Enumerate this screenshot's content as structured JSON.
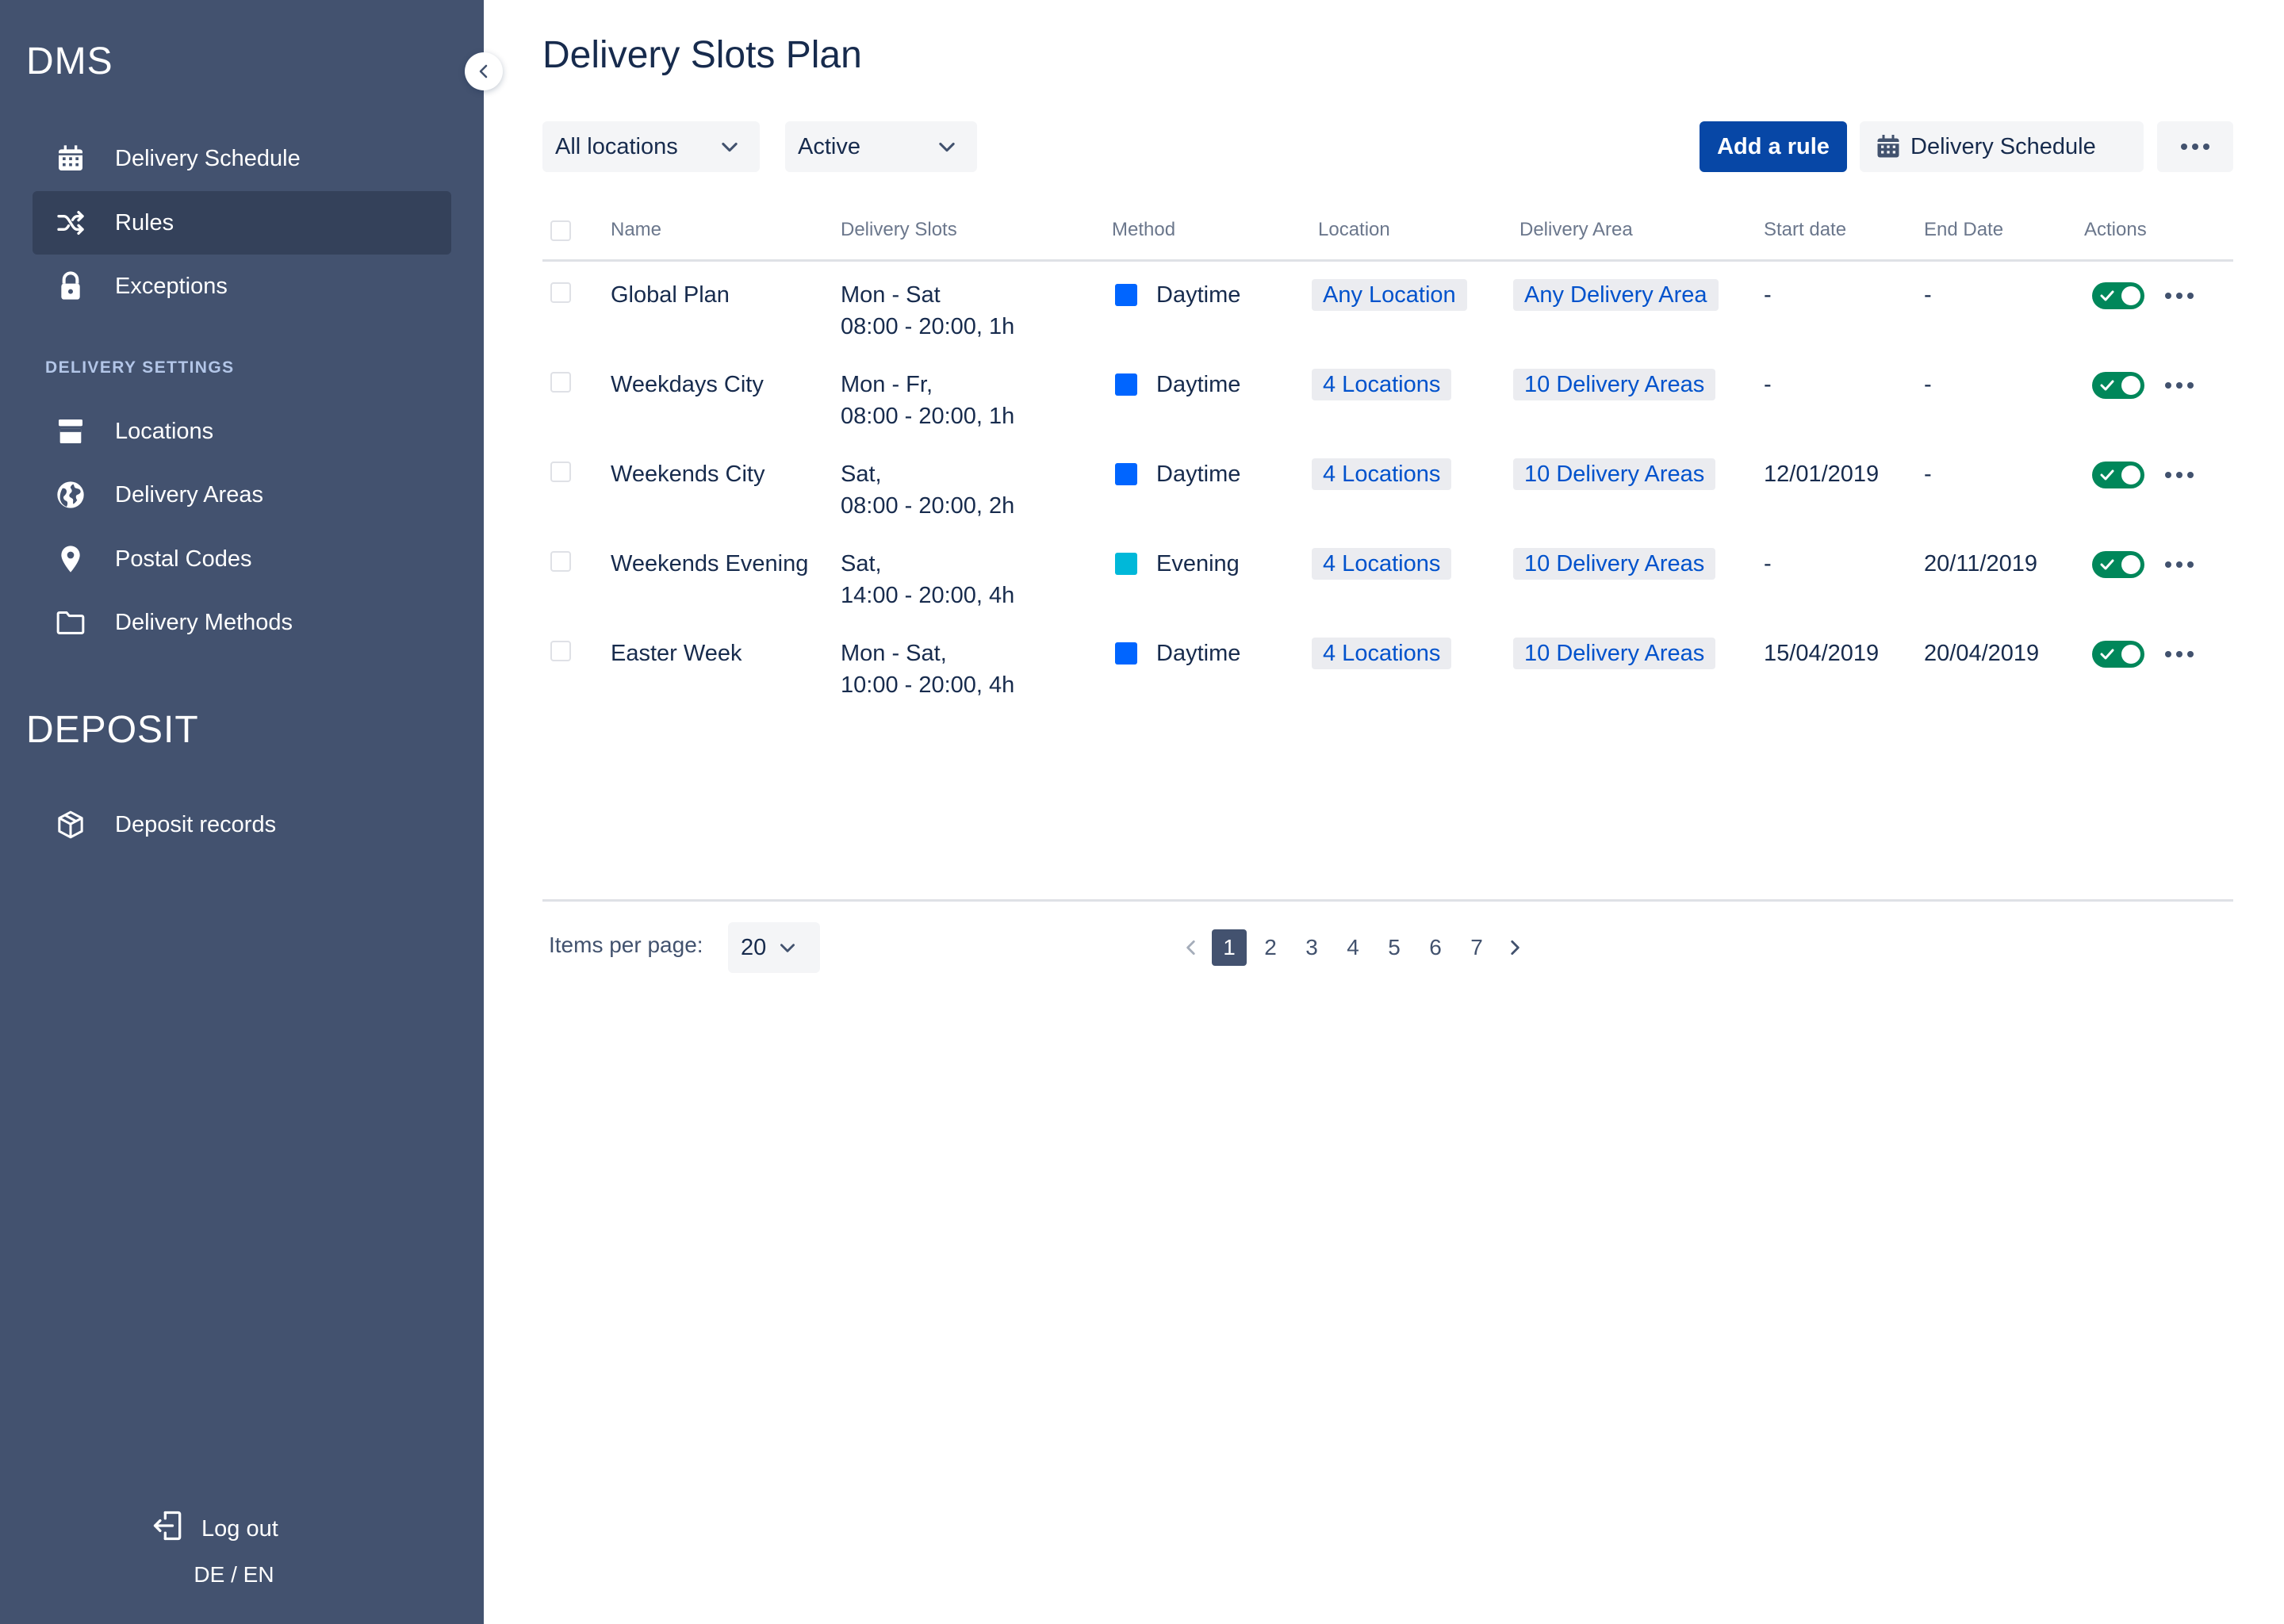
{
  "sidebar": {
    "brand": "DMS",
    "nav": [
      {
        "label": "Delivery Schedule",
        "icon": "calendar-icon",
        "active": false
      },
      {
        "label": "Rules",
        "icon": "shuffle-icon",
        "active": true
      },
      {
        "label": "Exceptions",
        "icon": "lock-icon",
        "active": false
      }
    ],
    "section_title": "DELIVERY SETTINGS",
    "settings": [
      {
        "label": "Locations",
        "icon": "store-icon"
      },
      {
        "label": "Delivery Areas",
        "icon": "globe-icon"
      },
      {
        "label": "Postal Codes",
        "icon": "location-pin-icon"
      },
      {
        "label": "Delivery Methods",
        "icon": "folder-icon"
      }
    ],
    "deposit_brand": "DEPOSIT",
    "deposit_items": [
      {
        "label": "Deposit records",
        "icon": "package-icon"
      }
    ],
    "logout_label": "Log out",
    "language": "DE / EN"
  },
  "page": {
    "title": "Delivery Slots Plan",
    "filters": {
      "location": "All locations",
      "status": "Active"
    },
    "add_rule_label": "Add a rule",
    "schedule_button_label": "Delivery Schedule"
  },
  "table": {
    "headers": {
      "name": "Name",
      "slots": "Delivery Slots",
      "method": "Method",
      "location": "Location",
      "area": "Delivery Area",
      "start": "Start date",
      "end": "End Date",
      "actions": "Actions"
    },
    "rows": [
      {
        "name": "Global Plan",
        "slot_days": "Mon - Sat",
        "slot_time": "08:00 - 20:00, 1h",
        "method": "Daytime",
        "method_color": "#0065FF",
        "location": "Any Location",
        "area": "Any Delivery Area",
        "start": "-",
        "end": "-",
        "enabled": true
      },
      {
        "name": "Weekdays City",
        "slot_days": "Mon - Fr,",
        "slot_time": "08:00 - 20:00, 1h",
        "method": "Daytime",
        "method_color": "#0065FF",
        "location": "4 Locations",
        "area": "10 Delivery Areas",
        "start": "-",
        "end": "-",
        "enabled": true
      },
      {
        "name": "Weekends City",
        "slot_days": "Sat,",
        "slot_time": "08:00 - 20:00, 2h",
        "method": "Daytime",
        "method_color": "#0065FF",
        "location": "4 Locations",
        "area": "10 Delivery Areas",
        "start": "12/01/2019",
        "end": "-",
        "enabled": true
      },
      {
        "name": "Weekends Evening",
        "slot_days": "Sat,",
        "slot_time": "14:00 - 20:00, 4h",
        "method": "Evening",
        "method_color": "#00B8D9",
        "location": "4 Locations",
        "area": "10 Delivery Areas",
        "start": "-",
        "end": "20/11/2019",
        "enabled": true
      },
      {
        "name": "Easter Week",
        "slot_days": "Mon - Sat,",
        "slot_time": "10:00 - 20:00, 4h",
        "method": "Daytime",
        "method_color": "#0065FF",
        "location": "4 Locations",
        "area": "10 Delivery Areas",
        "start": "15/04/2019",
        "end": "20/04/2019",
        "enabled": true
      }
    ]
  },
  "pagination": {
    "items_per_page_label": "Items per page:",
    "items_per_page": "20",
    "pages": [
      "1",
      "2",
      "3",
      "4",
      "5",
      "6",
      "7"
    ],
    "current_page": "1"
  },
  "colors": {
    "sidebar_bg": "#43526F",
    "sidebar_active": "#34415A",
    "primary": "#0747A6",
    "link": "#0052CC",
    "toggle_on": "#00875A"
  }
}
